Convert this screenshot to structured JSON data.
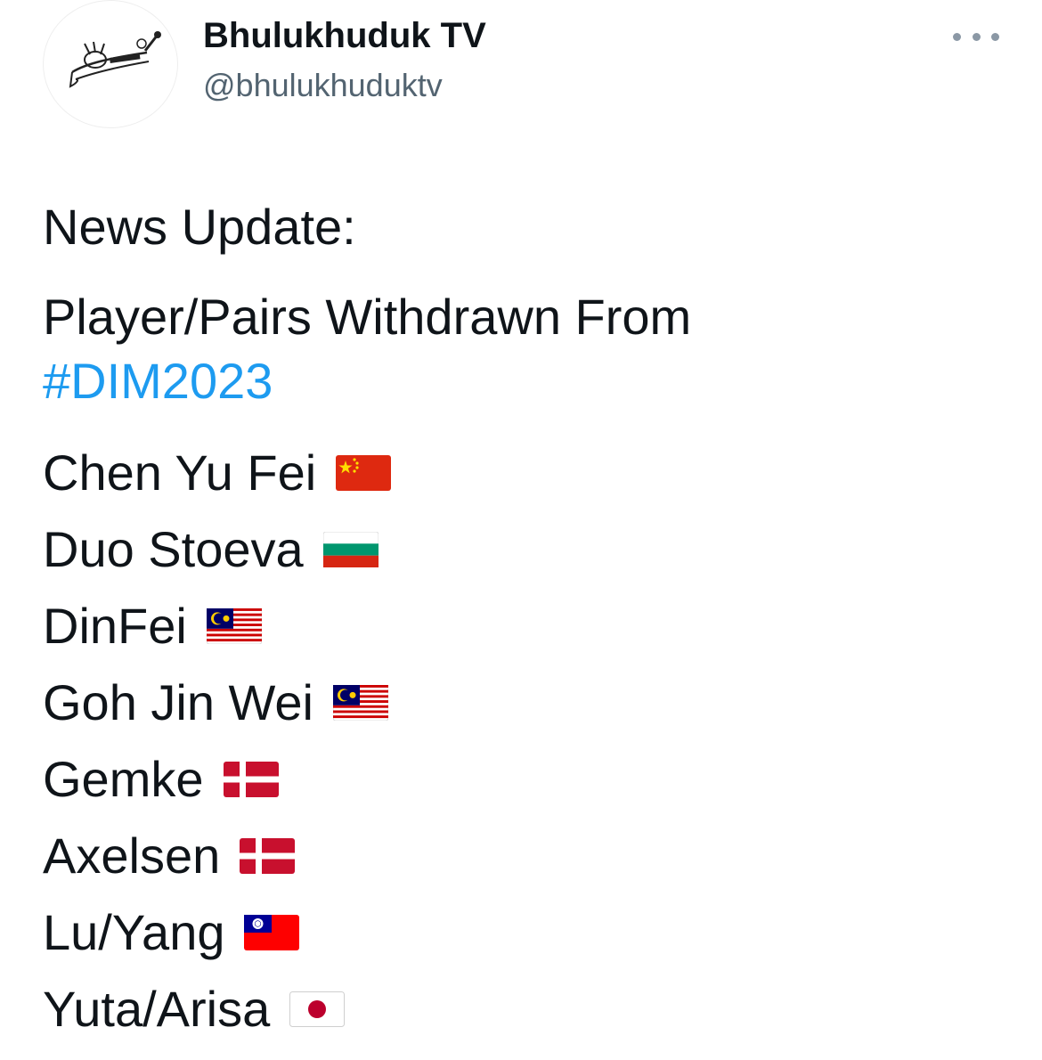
{
  "account": {
    "name": "Bhulukhuduk TV",
    "handle": "@bhulukhuduktv",
    "avatar_icon": "badminton-logo-icon",
    "more_icon": "more-options-icon"
  },
  "tweet": {
    "heading": "News Update:",
    "subheading": "Player/Pairs Withdrawn From",
    "hashtag": "#DIM2023",
    "players": [
      {
        "name": "Chen Yu Fei",
        "flag": "china-flag-icon"
      },
      {
        "name": "Duo Stoeva",
        "flag": "bulgaria-flag-icon"
      },
      {
        "name": "DinFei",
        "flag": "malaysia-flag-icon"
      },
      {
        "name": "Goh Jin Wei",
        "flag": "malaysia-flag-icon"
      },
      {
        "name": "Gemke",
        "flag": "denmark-flag-icon"
      },
      {
        "name": "Axelsen",
        "flag": "denmark-flag-icon"
      },
      {
        "name": "Lu/Yang",
        "flag": "taiwan-flag-icon"
      },
      {
        "name": "Yuta/Arisa",
        "flag": "japan-flag-icon"
      }
    ]
  },
  "colors": {
    "text": "#0f1419",
    "secondary": "#536471",
    "link": "#1d9bf0"
  }
}
